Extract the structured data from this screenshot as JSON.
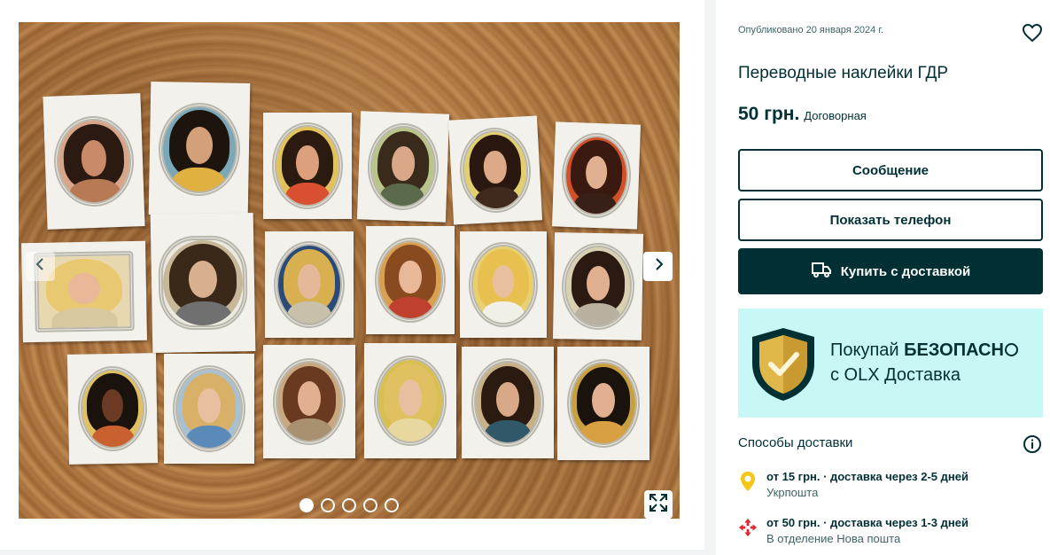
{
  "gallery": {
    "image_alt": "Переводные наклейки ГДР",
    "prev_icon": "chevron-left-icon",
    "next_icon": "chevron-right-icon",
    "expand_icon": "expand-icon",
    "dot_count": 5,
    "active_dot": 1
  },
  "ad": {
    "published": "Опубликовано 20 января 2024 г.",
    "title": "Переводные наклейки ГДР",
    "price": "50 грн.",
    "negotiable": "Договорная",
    "favorite_icon": "heart-icon"
  },
  "actions": {
    "message_label": "Сообщение",
    "phone_label": "Показать телефон",
    "buy_label": "Купить с доставкой",
    "buy_icon": "truck-icon"
  },
  "banner": {
    "line1_prefix": "Покупай ",
    "line1_bold": "БЕЗОПАСН",
    "line2": "с OLX Доставка",
    "icon": "shield-check-icon"
  },
  "delivery": {
    "title": "Способы доставки",
    "info_icon": "info-icon",
    "options": [
      {
        "main": "от 15 грн. · доставка через 2-5 дней",
        "sub": "Укрпошта",
        "icon": "ukrposhta-icon"
      },
      {
        "main": "от 50 грн. · доставка через 1-3 дней",
        "sub": "В отделение Нова пошта",
        "icon": "nova-poshta-icon"
      }
    ]
  },
  "colors": {
    "brand_dark": "#002f34",
    "banner_bg": "#c8f8f6",
    "shield_gold": "#e0b84a",
    "ukrposhta_yellow": "#f5c518",
    "nova_red": "#e3262d"
  }
}
